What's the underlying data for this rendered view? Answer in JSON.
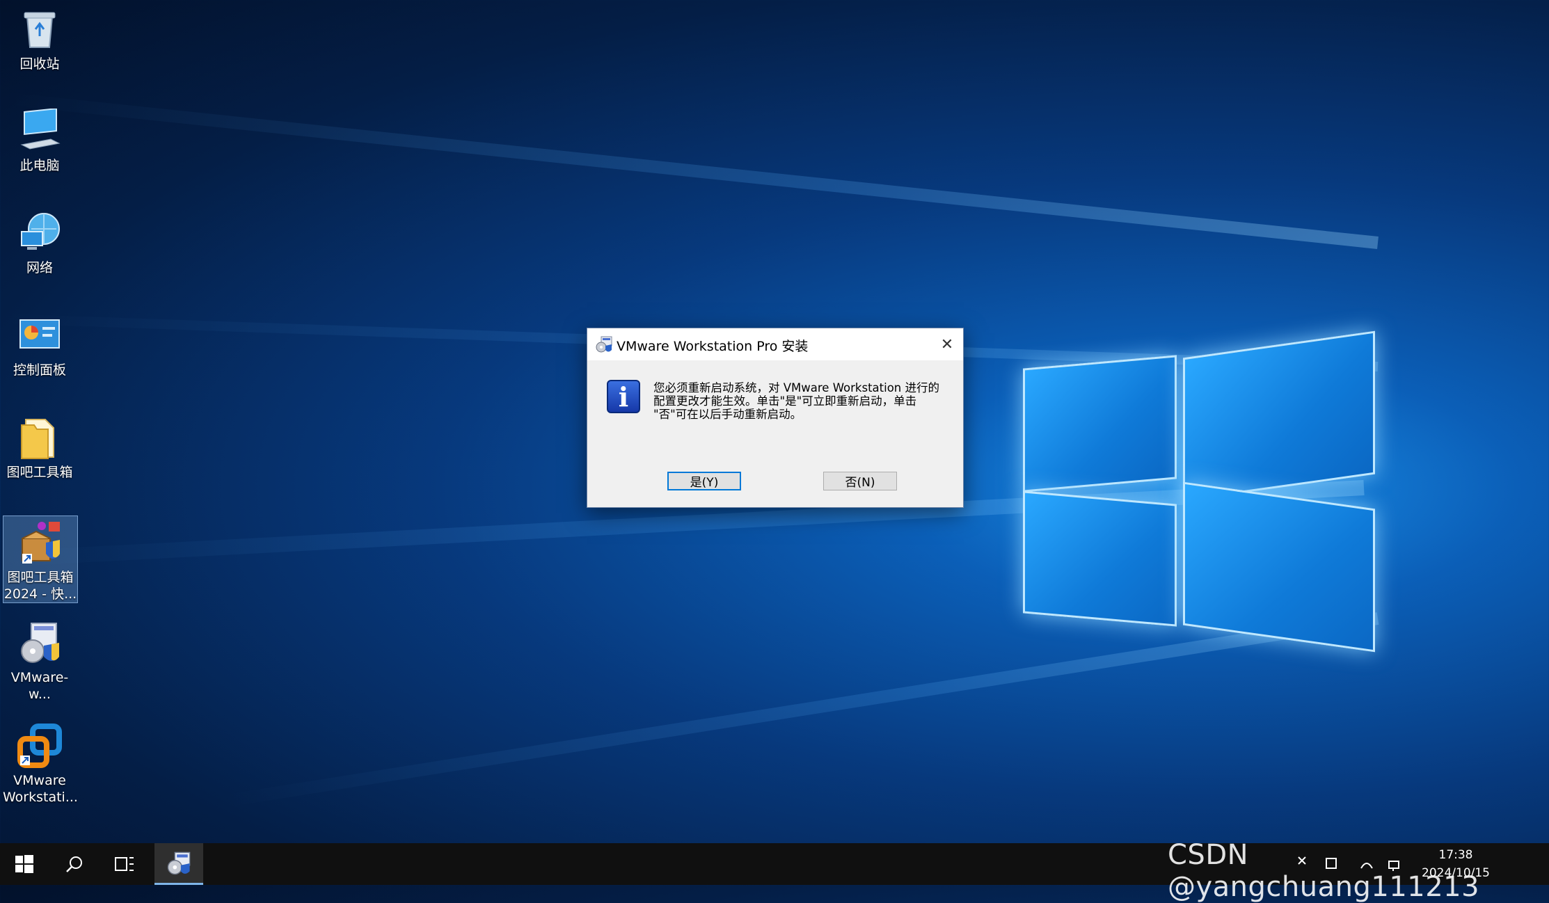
{
  "desktop": {
    "icons": [
      {
        "label": "回收站",
        "icon": "recycle-bin-icon"
      },
      {
        "label": "此电脑",
        "icon": "computer-icon"
      },
      {
        "label": "网络",
        "icon": "network-icon"
      },
      {
        "label": "控制面板",
        "icon": "control-panel-icon"
      },
      {
        "label": "图吧工具箱",
        "icon": "folder-icon"
      },
      {
        "label_line1": "图吧工具箱",
        "label_line2": "2024 - 快...",
        "icon": "toolbox-shortcut-icon"
      },
      {
        "label": "VMware-w...",
        "icon": "installer-icon"
      },
      {
        "label_line1": "VMware",
        "label_line2": "Workstati...",
        "icon": "vmware-icon"
      }
    ]
  },
  "dialog": {
    "title": "VMware Workstation Pro 安装",
    "message_line1": "您必须重新启动系统，对 VMware Workstation 进行的",
    "message_line2": "配置更改才能生效。单击\"是\"可立即重新启动，单击",
    "message_line3": "\"否\"可在以后手动重新启动。",
    "yes_label": "是(Y)",
    "no_label": "否(N)",
    "close_glyph": "✕"
  },
  "taskbar": {
    "clock_time": "17:38",
    "clock_date": "2024/10/15",
    "watermark": "CSDN @yangchuang111213"
  }
}
